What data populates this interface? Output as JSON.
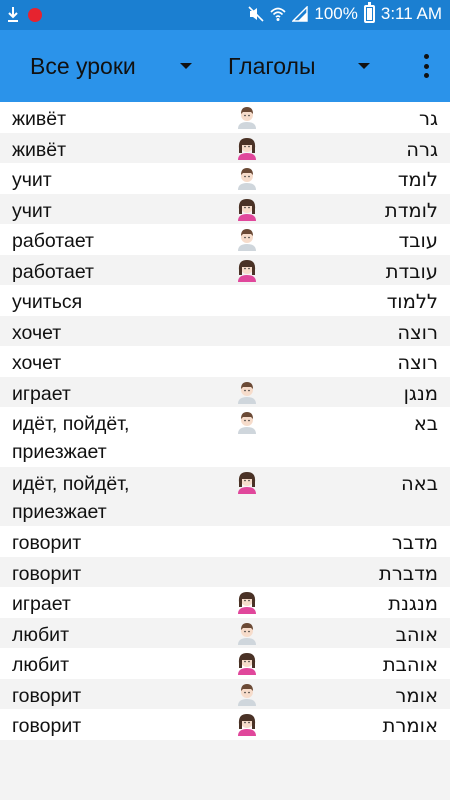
{
  "status_bar": {
    "battery": "100%",
    "time": "3:11 AM",
    "icons": [
      "download-icon",
      "record-icon",
      "mute-icon",
      "wifi-icon",
      "signal-icon",
      "battery-icon"
    ]
  },
  "toolbar": {
    "lessons_spinner": "Все уроки",
    "category_spinner": "Глаголы",
    "overflow_icon": "more-vert-icon"
  },
  "words": [
    {
      "ru": "живёт",
      "he": "גר",
      "gender": "male"
    },
    {
      "ru": "живёт",
      "he": "גרה",
      "gender": "female"
    },
    {
      "ru": "учит",
      "he": "לומד",
      "gender": "male"
    },
    {
      "ru": "учит",
      "he": "לומדת",
      "gender": "female"
    },
    {
      "ru": "работает",
      "he": "עובד",
      "gender": "male"
    },
    {
      "ru": "работает",
      "he": "עובדת",
      "gender": "female"
    },
    {
      "ru": "учиться",
      "he": "ללמוד",
      "gender": "none"
    },
    {
      "ru": "хочет",
      "he": "רוצה",
      "gender": "none"
    },
    {
      "ru": "хочет",
      "he": "רוצה",
      "gender": "none"
    },
    {
      "ru": "играет",
      "he": "מנגן",
      "gender": "male"
    },
    {
      "ru": "идёт, пойдёт, приезжает",
      "he": "בא",
      "gender": "male"
    },
    {
      "ru": "идёт, пойдёт, приезжает",
      "he": "באה",
      "gender": "female"
    },
    {
      "ru": "говорит",
      "he": "מדבר",
      "gender": "none"
    },
    {
      "ru": "говорит",
      "he": "מדברת",
      "gender": "none"
    },
    {
      "ru": "играет",
      "he": "מנגנת",
      "gender": "female"
    },
    {
      "ru": "любит",
      "he": "אוהב",
      "gender": "male"
    },
    {
      "ru": "любит",
      "he": "אוהבת",
      "gender": "female"
    },
    {
      "ru": "говорит",
      "he": "אומר",
      "gender": "male"
    },
    {
      "ru": "говорит",
      "he": "אומרת",
      "gender": "female"
    }
  ]
}
